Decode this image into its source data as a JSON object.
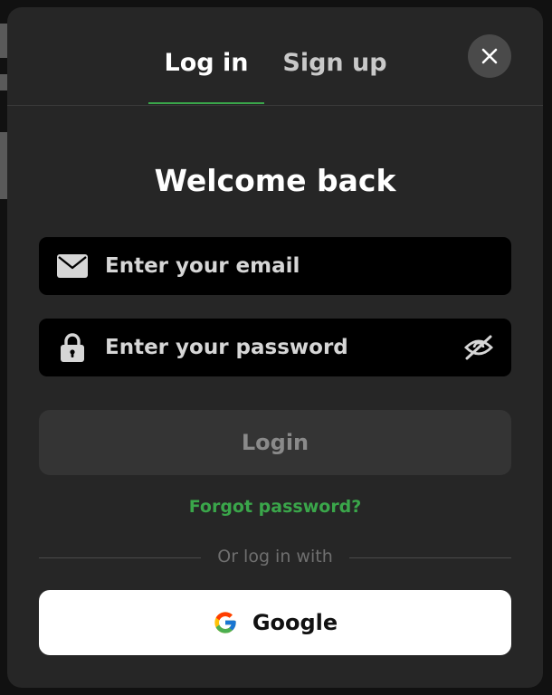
{
  "tabs": [
    {
      "label": "Log in",
      "active": true
    },
    {
      "label": "Sign up",
      "active": false
    }
  ],
  "close_icon": "close-icon",
  "heading": "Welcome back",
  "email": {
    "placeholder": "Enter your email",
    "value": "",
    "icon": "envelope-icon"
  },
  "password": {
    "placeholder": "Enter your password",
    "value": "",
    "icon": "lock-icon",
    "toggle_icon": "eye-off-icon"
  },
  "login_button": {
    "label": "Login",
    "state": "disabled"
  },
  "forgot_link": "Forgot password?",
  "divider_text": "Or log in with",
  "google_button": {
    "label": "Google",
    "icon": "google-icon"
  },
  "colors": {
    "modal_bg": "#262626",
    "accent": "#3aa64a",
    "field_bg": "#000000",
    "button_disabled_bg": "#343434",
    "google_bg": "#ffffff"
  }
}
